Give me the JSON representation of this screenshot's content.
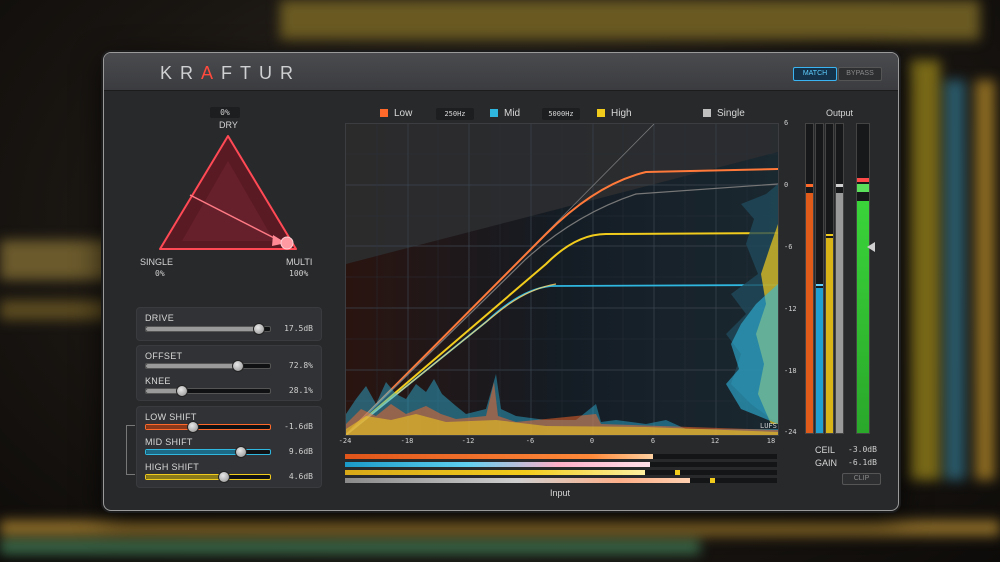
{
  "app": {
    "logo_prefix": "KR",
    "logo_mark": "A",
    "logo_suffix": "FTUR"
  },
  "header": {
    "match_label": "MATCH",
    "bypass_label": "BYPASS"
  },
  "triangle": {
    "dry_label": "DRY",
    "dry_value": "0%",
    "single_label": "SINGLE",
    "single_value": "0%",
    "multi_label": "MULTI",
    "multi_value": "100%"
  },
  "drive": {
    "label": "DRIVE",
    "value": "17.5dB",
    "level": 0.9
  },
  "offset": {
    "label": "OFFSET",
    "value": "72.8%",
    "level": 0.73
  },
  "knee": {
    "label": "KNEE",
    "value": "28.1%",
    "level": 0.28
  },
  "low_shift": {
    "label": "LOW SHIFT",
    "value": "-1.6dB",
    "level": 0.37
  },
  "mid_shift": {
    "label": "MID SHIFT",
    "value": "9.6dB",
    "level": 0.76
  },
  "high_shift": {
    "label": "HIGH SHIFT",
    "value": "4.6dB",
    "level": 0.62
  },
  "legend": {
    "low": {
      "label": "Low",
      "color": "#ff6a2a"
    },
    "low_freq": "250Hz",
    "mid": {
      "label": "Mid",
      "color": "#2fb7e0"
    },
    "mid_freq": "5000Hz",
    "high": {
      "label": "High",
      "color": "#f2cc1c"
    },
    "single": {
      "label": "Single",
      "color": "#bfbfbf"
    }
  },
  "x_ticks": [
    "-24",
    "-18",
    "-12",
    "-6",
    "0",
    "6",
    "12",
    "18"
  ],
  "y_ticks": [
    "6",
    "0",
    "-6",
    "-12",
    "-18",
    "-24"
  ],
  "lufs_label": "LUFS",
  "input_label": "Input",
  "output": {
    "title": "Output",
    "ceil_label": "CEIL",
    "ceil_value": "-3.0dB",
    "gain_label": "GAIN",
    "gain_value": "-6.1dB",
    "clip_label": "CLIP"
  }
}
